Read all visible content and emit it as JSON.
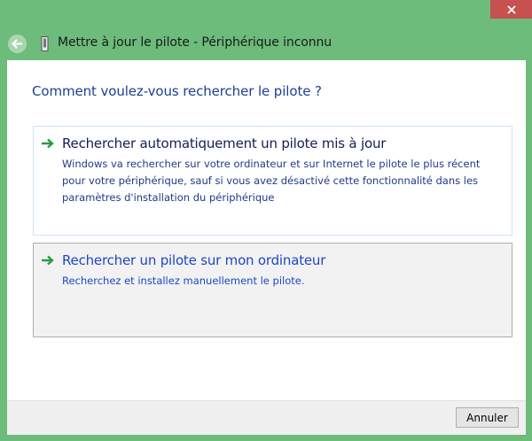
{
  "window": {
    "title": "Mettre à jour le pilote - Périphérique inconnu",
    "close_label": "x"
  },
  "icons": {
    "back": "back-arrow-icon",
    "device": "device-icon",
    "option_arrow": "green-arrow-icon"
  },
  "colors": {
    "window_frame": "#6dbc7b",
    "close_button": "#c75050",
    "heading": "#1c3f94",
    "link": "#1f46c4",
    "arrow": "#2a9d3c"
  },
  "main": {
    "heading": "Comment voulez-vous rechercher le pilote ?",
    "options": [
      {
        "title": "Rechercher automatiquement un pilote mis à jour",
        "description": "Windows va rechercher sur votre ordinateur et sur Internet le pilote le plus récent pour votre périphérique, sauf si vous avez désactivé cette fonctionnalité dans les paramètres d'installation du périphérique"
      },
      {
        "title": "Rechercher un pilote sur mon ordinateur",
        "description": "Recherchez et installez manuellement le pilote."
      }
    ]
  },
  "footer": {
    "cancel_label": "Annuler"
  }
}
